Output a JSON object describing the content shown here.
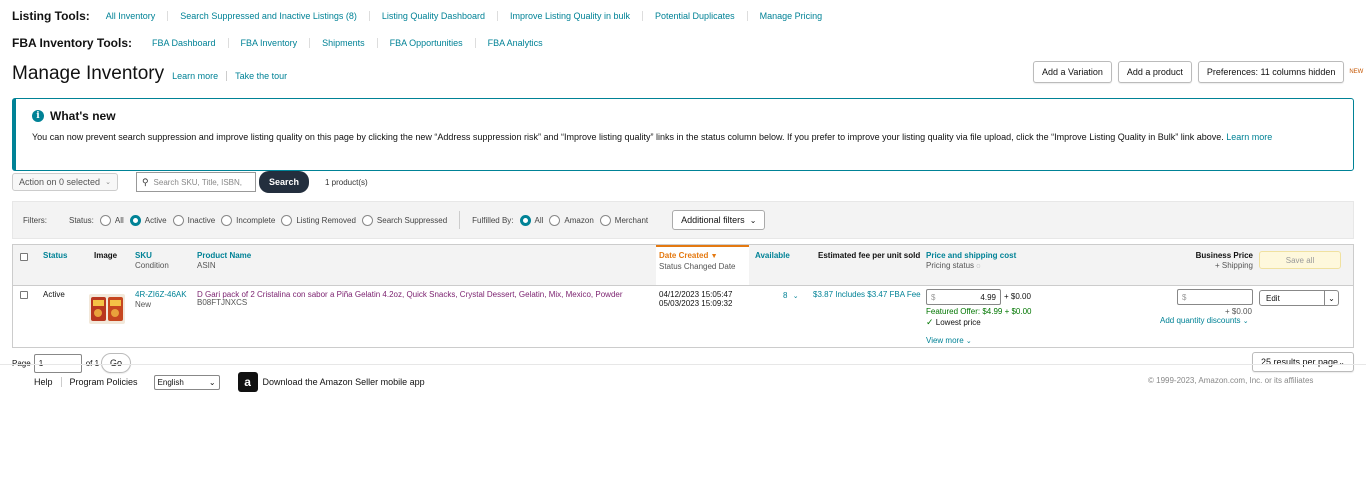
{
  "listing_tools": {
    "title": "Listing Tools:",
    "links": [
      "All Inventory",
      "Search Suppressed and Inactive Listings (8)",
      "Listing Quality Dashboard",
      "Improve Listing Quality in bulk",
      "Potential Duplicates",
      "Manage Pricing"
    ]
  },
  "fba_tools": {
    "title": "FBA Inventory Tools:",
    "links": [
      "FBA Dashboard",
      "FBA Inventory",
      "Shipments",
      "FBA Opportunities",
      "FBA Analytics"
    ]
  },
  "page": {
    "title": "Manage Inventory",
    "learn_more": "Learn more",
    "take_tour": "Take the tour",
    "add_variation": "Add a Variation",
    "add_product": "Add a product",
    "preferences": "Preferences: 11 columns hidden",
    "new_badge": "NEW"
  },
  "whats_new": {
    "title": "What's new",
    "body": "You can now prevent search suppression and improve listing quality on this page by clicking the new “Address suppression risk” and “Improve listing quality” links in the status column below. If you prefer to improve your listing quality via file upload, click the “Improve Listing Quality in Bulk” link above.",
    "learn_more": "Learn more"
  },
  "toolbar": {
    "action_label": "Action on 0 selected",
    "search_placeholder": "Search SKU, Title, ISBN,",
    "search_button": "Search",
    "count": "1 product(s)"
  },
  "filters": {
    "label": "Filters:",
    "status_label": "Status:",
    "status_options": [
      "All",
      "Active",
      "Inactive",
      "Incomplete",
      "Listing Removed",
      "Search Suppressed"
    ],
    "status_selected": "Active",
    "fulfilled_label": "Fulfilled By:",
    "fulfilled_options": [
      "All",
      "Amazon",
      "Merchant"
    ],
    "fulfilled_selected": "All",
    "additional": "Additional filters"
  },
  "table": {
    "headers": {
      "status": "Status",
      "image": "Image",
      "sku": "SKU",
      "sku_sub": "Condition",
      "product_name": "Product Name",
      "product_sub": "ASIN",
      "date_created": "Date Created",
      "date_sub": "Status Changed Date",
      "available": "Available",
      "fee": "Estimated fee per unit sold",
      "price": "Price and shipping cost",
      "price_sub": "Pricing status",
      "business_price": "Business Price",
      "business_sub": "+ Shipping",
      "save_all": "Save all"
    },
    "rows": [
      {
        "status": "Active",
        "sku": "4R-ZI6Z-46AK",
        "condition": "New",
        "product_name": "D Gari pack of 2 Cristalina con sabor a Piña Gelatin 4.2oz, Quick Snacks, Crystal Dessert, Gelatin, Mix, Mexico, Powder",
        "asin": "B08FTJNXCS",
        "date_created": "04/12/2023 15:05:47",
        "status_changed": "05/03/2023 15:09:32",
        "available": "8",
        "fee": "$3.87 Includes $3.47 FBA Fee",
        "price_currency": "$",
        "price": "4.99",
        "shipping": "+ $0.00",
        "featured_offer": "Featured Offer: $4.99 + $0.00",
        "lowest_price": "Lowest price",
        "view_more": "View more",
        "business_currency": "$",
        "business_shipping": "+ $0.00",
        "quantity_discounts": "Add quantity discounts",
        "edit": "Edit"
      }
    ]
  },
  "pager": {
    "page_label": "Page",
    "page_value": "1",
    "of_label": "of 1",
    "go": "Go",
    "results_per_page": "25 results per page"
  },
  "footer": {
    "help": "Help",
    "policies": "Program Policies",
    "language": "English",
    "app_text": "Download the Amazon Seller mobile app",
    "copyright": "© 1999-2023, Amazon.com, Inc. or its affiliates"
  }
}
